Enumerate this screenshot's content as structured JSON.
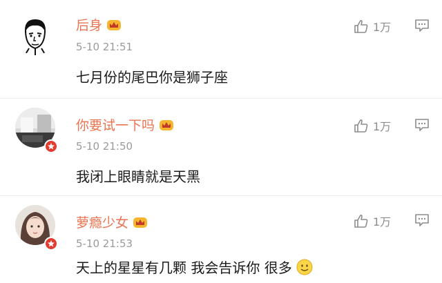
{
  "comments": [
    {
      "username": "后身",
      "time": "5-10 21:51",
      "text": "七月份的尾巴你是狮子座",
      "likes": "1万",
      "avatar": "cartoon-man-avatar",
      "has_badge": false
    },
    {
      "username": "你要试一下吗",
      "time": "5-10 21:50",
      "text": "我闭上眼睛就是天黑",
      "likes": "1万",
      "avatar": "room-photo-avatar",
      "has_badge": true
    },
    {
      "username": "萝瘾少女",
      "time": "5-10 21:53",
      "text": "天上的星星有几颗 我会告诉你 很多",
      "likes": "1万",
      "avatar": "girl-photo-avatar",
      "has_badge": true
    }
  ],
  "colors": {
    "username": "#eb7350",
    "time": "#9a9a9a",
    "badge": "#e23c2e",
    "vip_gold": "#f5b52e"
  }
}
